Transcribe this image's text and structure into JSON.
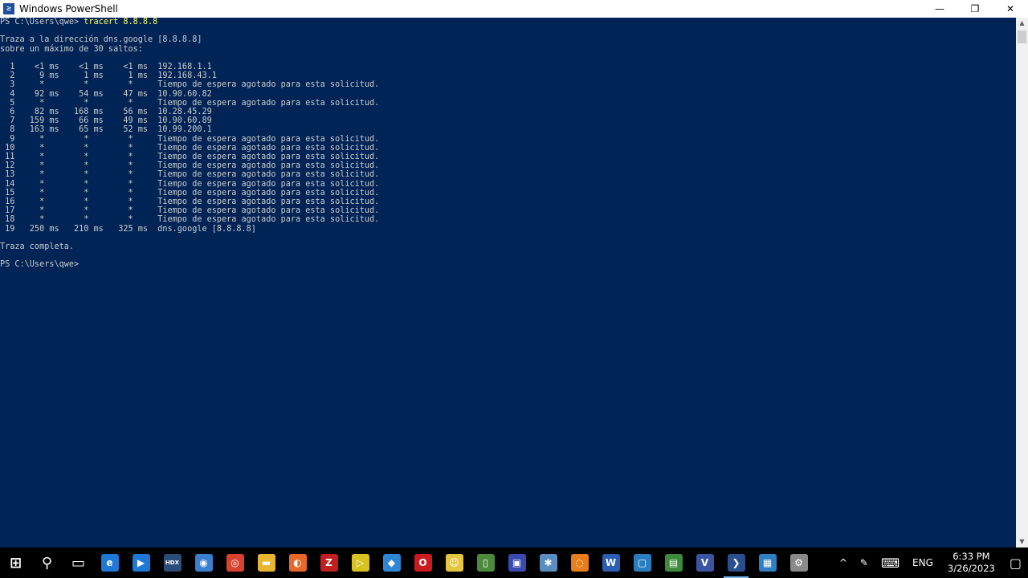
{
  "window": {
    "title": "Windows PowerShell",
    "icon_name": "powershell-icon",
    "controls": {
      "minimize": "—",
      "restore": "❐",
      "close": "✕"
    }
  },
  "console": {
    "prompt": "PS C:\\Users\\qwe> ",
    "command": "tracert 8.8.8.8",
    "output": [
      "",
      "Traza a la dirección dns.google [8.8.8.8]",
      "sobre un máximo de 30 saltos:",
      "",
      "  1    <1 ms    <1 ms    <1 ms  192.168.1.1",
      "  2     9 ms     1 ms     1 ms  192.168.43.1",
      "  3     *        *        *     Tiempo de espera agotado para esta solicitud.",
      "  4    92 ms    54 ms    47 ms  10.90.60.82",
      "  5     *        *        *     Tiempo de espera agotado para esta solicitud.",
      "  6    82 ms   168 ms    56 ms  10.28.45.29",
      "  7   159 ms    66 ms    49 ms  10.90.60.89",
      "  8   163 ms    65 ms    52 ms  10.99.200.1",
      "  9     *        *        *     Tiempo de espera agotado para esta solicitud.",
      " 10     *        *        *     Tiempo de espera agotado para esta solicitud.",
      " 11     *        *        *     Tiempo de espera agotado para esta solicitud.",
      " 12     *        *        *     Tiempo de espera agotado para esta solicitud.",
      " 13     *        *        *     Tiempo de espera agotado para esta solicitud.",
      " 14     *        *        *     Tiempo de espera agotado para esta solicitud.",
      " 15     *        *        *     Tiempo de espera agotado para esta solicitud.",
      " 16     *        *        *     Tiempo de espera agotado para esta solicitud.",
      " 17     *        *        *     Tiempo de espera agotado para esta solicitud.",
      " 18     *        *        *     Tiempo de espera agotado para esta solicitud.",
      " 19   250 ms   210 ms   325 ms  dns.google [8.8.8.8]",
      "",
      "Traza completa."
    ],
    "final_prompt": "PS C:\\Users\\qwe>"
  },
  "taskbar": {
    "apps": [
      {
        "name": "start-button",
        "icon": "windows-logo-icon",
        "glyph": "⊞",
        "color": "#ffffff"
      },
      {
        "name": "search-button",
        "icon": "search-icon",
        "glyph": "⚲",
        "color": "#ffffff"
      },
      {
        "name": "task-view-button",
        "icon": "task-view-icon",
        "glyph": "▭",
        "color": "#ffffff"
      },
      {
        "name": "edge-app",
        "icon": "edge-icon",
        "glyph": "e",
        "color": "#1e78d6"
      },
      {
        "name": "media-player-app",
        "icon": "play-icon",
        "glyph": "▶",
        "color": "#1e78d6"
      },
      {
        "name": "hdx-app",
        "icon": "hdx-icon",
        "glyph": "HDX",
        "color": "#2a4d7a"
      },
      {
        "name": "chat-app",
        "icon": "chat-bubble-icon",
        "glyph": "◉",
        "color": "#3a7fd0"
      },
      {
        "name": "chrome-app",
        "icon": "chrome-icon",
        "glyph": "◎",
        "color": "#d9422e"
      },
      {
        "name": "file-explorer-app",
        "icon": "folder-icon",
        "glyph": "▬",
        "color": "#e8b630"
      },
      {
        "name": "firefox-app",
        "icon": "firefox-icon",
        "glyph": "◐",
        "color": "#e8682a"
      },
      {
        "name": "filezilla-app",
        "icon": "filezilla-icon",
        "glyph": "Z",
        "color": "#bf1f1f"
      },
      {
        "name": "player-app",
        "icon": "player-icon",
        "glyph": "▷",
        "color": "#d8c21f"
      },
      {
        "name": "bird-app",
        "icon": "bird-icon",
        "glyph": "◆",
        "color": "#2e86d4"
      },
      {
        "name": "opera-app",
        "icon": "opera-icon",
        "glyph": "O",
        "color": "#cc1b20"
      },
      {
        "name": "sticky-app",
        "icon": "smiley-icon",
        "glyph": "☺",
        "color": "#e4c640"
      },
      {
        "name": "phone-app",
        "icon": "phone-icon",
        "glyph": "▯",
        "color": "#4c8a3c"
      },
      {
        "name": "save-app",
        "icon": "floppy-icon",
        "glyph": "▣",
        "color": "#3a4bb0"
      },
      {
        "name": "network-app",
        "icon": "network-icon",
        "glyph": "✱",
        "color": "#5a8ec0"
      },
      {
        "name": "orange-app",
        "icon": "orange-app-icon",
        "glyph": "◌",
        "color": "#e57e1b"
      },
      {
        "name": "word-app",
        "icon": "word-icon",
        "glyph": "W",
        "color": "#2b5fb3"
      },
      {
        "name": "virtualbox-app",
        "icon": "virtualbox-icon",
        "glyph": "▢",
        "color": "#2a7ec0"
      },
      {
        "name": "spreadsheet-app",
        "icon": "spreadsheet-icon",
        "glyph": "▤",
        "color": "#3c8c3c"
      },
      {
        "name": "visio-app",
        "icon": "visio-icon",
        "glyph": "V",
        "color": "#3955a3"
      },
      {
        "name": "powershell-app",
        "icon": "powershell-icon",
        "glyph": "❯",
        "color": "#2a4f8f",
        "active": true
      },
      {
        "name": "remote-desktop-app",
        "icon": "remote-desktop-icon",
        "glyph": "▦",
        "color": "#2f7fc4"
      },
      {
        "name": "settings-app",
        "icon": "tools-icon",
        "glyph": "⚙",
        "color": "#8a8a8a"
      }
    ],
    "tray": {
      "chevron": "^",
      "pen": "✎",
      "keyboard": "⌨",
      "language": "ENG",
      "time": "6:33 PM",
      "date": "3/26/2023",
      "notification": "▢"
    }
  },
  "colors": {
    "console_bg": "#012456",
    "console_text": "#cccccc",
    "command_text": "#ffff60"
  }
}
